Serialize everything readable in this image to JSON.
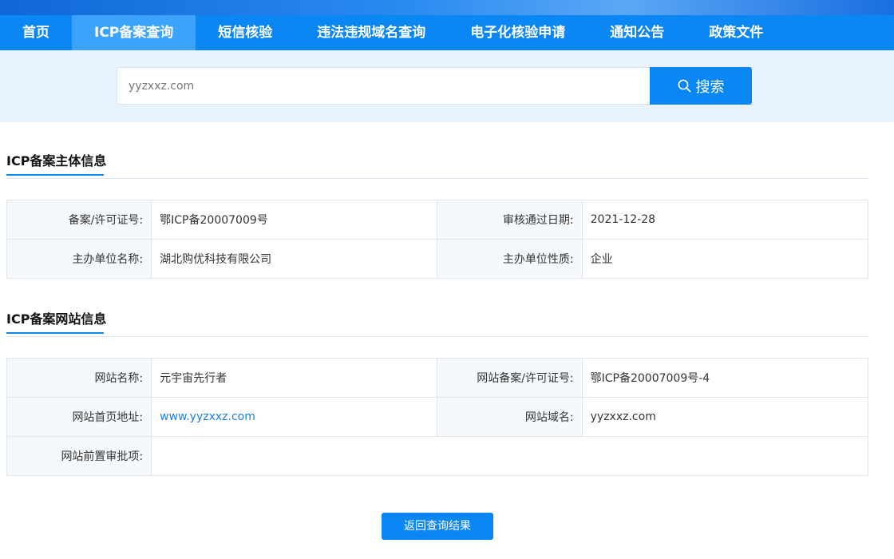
{
  "nav": {
    "items": [
      {
        "label": "首页"
      },
      {
        "label": "ICP备案查询"
      },
      {
        "label": "短信核验"
      },
      {
        "label": "违法违规域名查询"
      },
      {
        "label": "电子化核验申请"
      },
      {
        "label": "通知公告"
      },
      {
        "label": "政策文件"
      }
    ],
    "active_index": 1
  },
  "search": {
    "value": "yyzxxz.com",
    "button_label": "搜索",
    "button_icon": "search-icon"
  },
  "subject_section": {
    "title": "ICP备案主体信息",
    "rows": [
      {
        "label1": "备案/许可证号:",
        "value1": "鄂ICP备20007009号",
        "label2": "审核通过日期:",
        "value2": "2021-12-28"
      },
      {
        "label1": "主办单位名称:",
        "value1": "湖北购优科技有限公司",
        "label2": "主办单位性质:",
        "value2": "企业"
      }
    ]
  },
  "site_section": {
    "title": "ICP备案网站信息",
    "rows": [
      {
        "label1": "网站名称:",
        "value1": "元宇宙先行者",
        "label2": "网站备案/许可证号:",
        "value2": "鄂ICP备20007009号-4"
      },
      {
        "label1": "网站首页地址:",
        "value1": "www.yyzxxz.com",
        "label2": "网站域名:",
        "value2": "yyzxxz.com"
      },
      {
        "label1": "网站前置审批项:",
        "value1": ""
      }
    ]
  },
  "back_button_label": "返回查询结果",
  "colors": {
    "primary": "#0b87f3",
    "nav_active": "#3ba3fb",
    "search_band": "#e8f3fd",
    "link": "#1a7fe8"
  }
}
